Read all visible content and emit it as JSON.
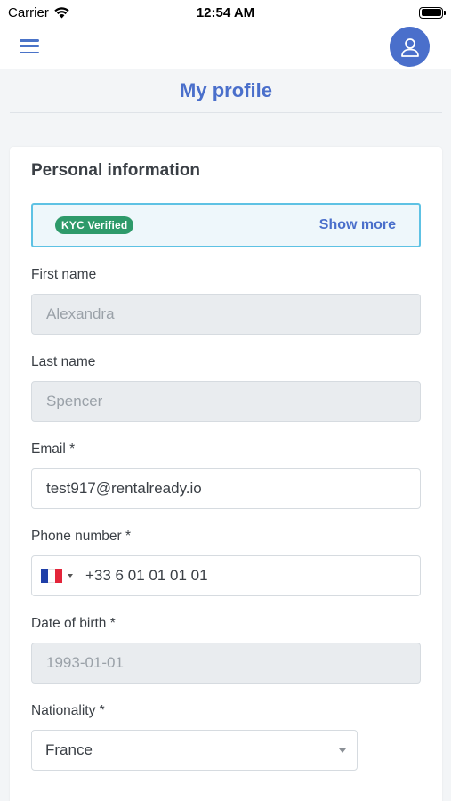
{
  "status_bar": {
    "carrier": "Carrier",
    "time": "12:54 AM"
  },
  "header": {
    "menu_icon": "hamburger-menu-icon",
    "avatar_icon": "user-icon",
    "accent_color": "#4a6fcb"
  },
  "page": {
    "title": "My profile"
  },
  "personal_info": {
    "section_title": "Personal information",
    "kyc_badge": "KYC Verified",
    "show_more": "Show more",
    "fields": {
      "first_name": {
        "label": "First name",
        "value": "Alexandra"
      },
      "last_name": {
        "label": "Last name",
        "value": "Spencer"
      },
      "email": {
        "label": "Email *",
        "value": "test917@rentalready.io"
      },
      "phone": {
        "label": "Phone number *",
        "value": "+33 6 01 01 01 01",
        "country_flag": "france-flag-icon"
      },
      "dob": {
        "label": "Date of birth *",
        "value": "1993-01-01"
      },
      "nationality": {
        "label": "Nationality *",
        "value": "France"
      }
    }
  }
}
